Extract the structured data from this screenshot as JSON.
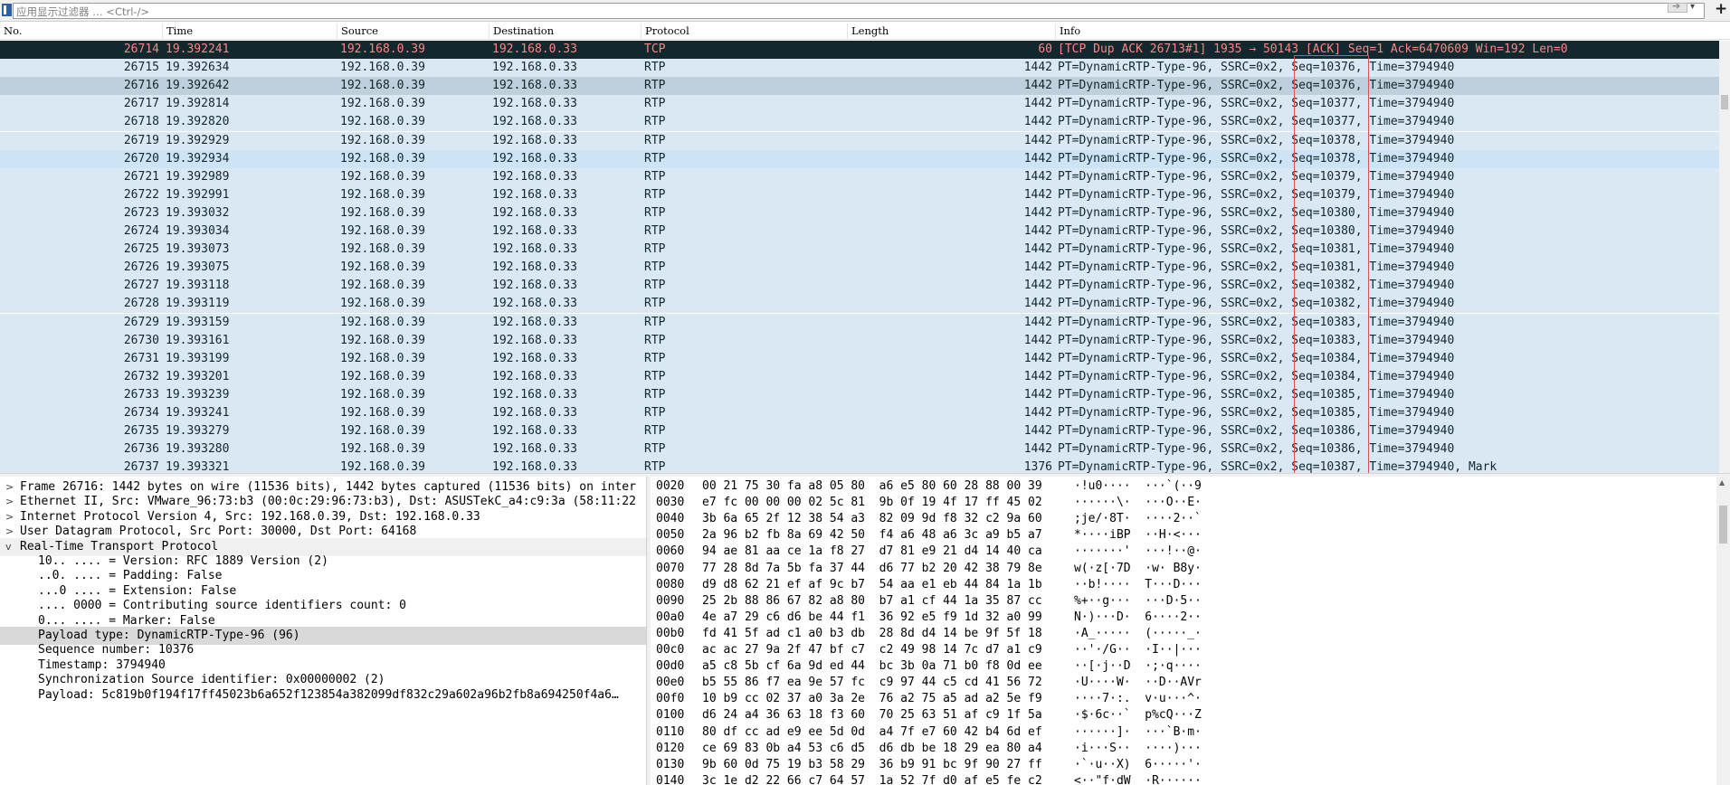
{
  "filter": {
    "placeholder": "应用显示过滤器 … <Ctrl-/>",
    "apply_icon": "arrow-right-icon",
    "dropdown_icon": "chevron-down-icon",
    "add_label": "+"
  },
  "packet_list": {
    "columns": [
      "No.",
      "Time",
      "Source",
      "Destination",
      "Protocol",
      "Length",
      "Info"
    ],
    "rows": [
      {
        "no": "26714",
        "time": "19.392241",
        "src": "192.168.0.39",
        "dst": "192.168.0.33",
        "proto": "TCP",
        "len": "60",
        "info": "[TCP Dup ACK 26713#1] 1935 → 50143 [ACK] Seq=1 Ack=6470609 Win=192 Len=0"
      },
      {
        "no": "26715",
        "time": "19.392634",
        "src": "192.168.0.39",
        "dst": "192.168.0.33",
        "proto": "RTP",
        "len": "1442",
        "info": "PT=DynamicRTP-Type-96, SSRC=0x2, Seq=10376, Time=3794940"
      },
      {
        "no": "26716",
        "time": "19.392642",
        "src": "192.168.0.39",
        "dst": "192.168.0.33",
        "proto": "RTP",
        "len": "1442",
        "info": "PT=DynamicRTP-Type-96, SSRC=0x2, Seq=10376, Time=3794940"
      },
      {
        "no": "26717",
        "time": "19.392814",
        "src": "192.168.0.39",
        "dst": "192.168.0.33",
        "proto": "RTP",
        "len": "1442",
        "info": "PT=DynamicRTP-Type-96, SSRC=0x2, Seq=10377, Time=3794940"
      },
      {
        "no": "26718",
        "time": "19.392820",
        "src": "192.168.0.39",
        "dst": "192.168.0.33",
        "proto": "RTP",
        "len": "1442",
        "info": "PT=DynamicRTP-Type-96, SSRC=0x2, Seq=10377, Time=3794940"
      },
      {
        "no": "26719",
        "time": "19.392929",
        "src": "192.168.0.39",
        "dst": "192.168.0.33",
        "proto": "RTP",
        "len": "1442",
        "info": "PT=DynamicRTP-Type-96, SSRC=0x2, Seq=10378, Time=3794940"
      },
      {
        "no": "26720",
        "time": "19.392934",
        "src": "192.168.0.39",
        "dst": "192.168.0.33",
        "proto": "RTP",
        "len": "1442",
        "info": "PT=DynamicRTP-Type-96, SSRC=0x2, Seq=10378, Time=3794940"
      },
      {
        "no": "26721",
        "time": "19.392989",
        "src": "192.168.0.39",
        "dst": "192.168.0.33",
        "proto": "RTP",
        "len": "1442",
        "info": "PT=DynamicRTP-Type-96, SSRC=0x2, Seq=10379, Time=3794940"
      },
      {
        "no": "26722",
        "time": "19.392991",
        "src": "192.168.0.39",
        "dst": "192.168.0.33",
        "proto": "RTP",
        "len": "1442",
        "info": "PT=DynamicRTP-Type-96, SSRC=0x2, Seq=10379, Time=3794940"
      },
      {
        "no": "26723",
        "time": "19.393032",
        "src": "192.168.0.39",
        "dst": "192.168.0.33",
        "proto": "RTP",
        "len": "1442",
        "info": "PT=DynamicRTP-Type-96, SSRC=0x2, Seq=10380, Time=3794940"
      },
      {
        "no": "26724",
        "time": "19.393034",
        "src": "192.168.0.39",
        "dst": "192.168.0.33",
        "proto": "RTP",
        "len": "1442",
        "info": "PT=DynamicRTP-Type-96, SSRC=0x2, Seq=10380, Time=3794940"
      },
      {
        "no": "26725",
        "time": "19.393073",
        "src": "192.168.0.39",
        "dst": "192.168.0.33",
        "proto": "RTP",
        "len": "1442",
        "info": "PT=DynamicRTP-Type-96, SSRC=0x2, Seq=10381, Time=3794940"
      },
      {
        "no": "26726",
        "time": "19.393075",
        "src": "192.168.0.39",
        "dst": "192.168.0.33",
        "proto": "RTP",
        "len": "1442",
        "info": "PT=DynamicRTP-Type-96, SSRC=0x2, Seq=10381, Time=3794940"
      },
      {
        "no": "26727",
        "time": "19.393118",
        "src": "192.168.0.39",
        "dst": "192.168.0.33",
        "proto": "RTP",
        "len": "1442",
        "info": "PT=DynamicRTP-Type-96, SSRC=0x2, Seq=10382, Time=3794940"
      },
      {
        "no": "26728",
        "time": "19.393119",
        "src": "192.168.0.39",
        "dst": "192.168.0.33",
        "proto": "RTP",
        "len": "1442",
        "info": "PT=DynamicRTP-Type-96, SSRC=0x2, Seq=10382, Time=3794940"
      },
      {
        "no": "26729",
        "time": "19.393159",
        "src": "192.168.0.39",
        "dst": "192.168.0.33",
        "proto": "RTP",
        "len": "1442",
        "info": "PT=DynamicRTP-Type-96, SSRC=0x2, Seq=10383, Time=3794940"
      },
      {
        "no": "26730",
        "time": "19.393161",
        "src": "192.168.0.39",
        "dst": "192.168.0.33",
        "proto": "RTP",
        "len": "1442",
        "info": "PT=DynamicRTP-Type-96, SSRC=0x2, Seq=10383, Time=3794940"
      },
      {
        "no": "26731",
        "time": "19.393199",
        "src": "192.168.0.39",
        "dst": "192.168.0.33",
        "proto": "RTP",
        "len": "1442",
        "info": "PT=DynamicRTP-Type-96, SSRC=0x2, Seq=10384, Time=3794940"
      },
      {
        "no": "26732",
        "time": "19.393201",
        "src": "192.168.0.39",
        "dst": "192.168.0.33",
        "proto": "RTP",
        "len": "1442",
        "info": "PT=DynamicRTP-Type-96, SSRC=0x2, Seq=10384, Time=3794940"
      },
      {
        "no": "26733",
        "time": "19.393239",
        "src": "192.168.0.39",
        "dst": "192.168.0.33",
        "proto": "RTP",
        "len": "1442",
        "info": "PT=DynamicRTP-Type-96, SSRC=0x2, Seq=10385, Time=3794940"
      },
      {
        "no": "26734",
        "time": "19.393241",
        "src": "192.168.0.39",
        "dst": "192.168.0.33",
        "proto": "RTP",
        "len": "1442",
        "info": "PT=DynamicRTP-Type-96, SSRC=0x2, Seq=10385, Time=3794940"
      },
      {
        "no": "26735",
        "time": "19.393279",
        "src": "192.168.0.39",
        "dst": "192.168.0.33",
        "proto": "RTP",
        "len": "1442",
        "info": "PT=DynamicRTP-Type-96, SSRC=0x2, Seq=10386, Time=3794940"
      },
      {
        "no": "26736",
        "time": "19.393280",
        "src": "192.168.0.39",
        "dst": "192.168.0.33",
        "proto": "RTP",
        "len": "1442",
        "info": "PT=DynamicRTP-Type-96, SSRC=0x2, Seq=10386, Time=3794940"
      },
      {
        "no": "26737",
        "time": "19.393321",
        "src": "192.168.0.39",
        "dst": "192.168.0.33",
        "proto": "RTP",
        "len": "1376",
        "info": "PT=DynamicRTP-Type-96, SSRC=0x2, Seq=10387, Time=3794940, Mark"
      }
    ],
    "colors": {
      "rtp_bg": "#dae8f4",
      "rtp_fg": "#12272e",
      "tcp_bg": "#12272e",
      "tcp_fg": "#f78787",
      "selected_bg": "#bfcfdc",
      "seq_highlight": "#e05050"
    }
  },
  "details": {
    "rows": [
      {
        "twisty": ">",
        "level": 0,
        "text": "Frame 26716: 1442 bytes on wire (11536 bits), 1442 bytes captured (11536 bits) on inter"
      },
      {
        "twisty": ">",
        "level": 0,
        "text": "Ethernet II, Src: VMware_96:73:b3 (00:0c:29:96:73:b3), Dst: ASUSTekC_a4:c9:3a (58:11:22"
      },
      {
        "twisty": ">",
        "level": 0,
        "text": "Internet Protocol Version 4, Src: 192.168.0.39, Dst: 192.168.0.33"
      },
      {
        "twisty": ">",
        "level": 0,
        "text": "User Datagram Protocol, Src Port: 30000, Dst Port: 64168"
      },
      {
        "twisty": "v",
        "level": 0,
        "text": "Real-Time Transport Protocol"
      },
      {
        "twisty": "",
        "level": 1,
        "text": "10.. .... = Version: RFC 1889 Version (2)"
      },
      {
        "twisty": "",
        "level": 1,
        "text": "..0. .... = Padding: False"
      },
      {
        "twisty": "",
        "level": 1,
        "text": "...0 .... = Extension: False"
      },
      {
        "twisty": "",
        "level": 1,
        "text": ".... 0000 = Contributing source identifiers count: 0"
      },
      {
        "twisty": "",
        "level": 1,
        "text": "0... .... = Marker: False"
      },
      {
        "twisty": "",
        "level": 1,
        "text": "Payload type: DynamicRTP-Type-96 (96)"
      },
      {
        "twisty": "",
        "level": 1,
        "text": "Sequence number: 10376"
      },
      {
        "twisty": "",
        "level": 1,
        "text": "Timestamp: 3794940"
      },
      {
        "twisty": "",
        "level": 1,
        "text": "Synchronization Source identifier: 0x00000002 (2)"
      },
      {
        "twisty": "",
        "level": 1,
        "text": "Payload: 5c819b0f194f17ff45023b6a652f123854a382099df832c29a602a96b2fb8a694250f4a6…"
      }
    ]
  },
  "hex": {
    "rows": [
      {
        "offset": "0020",
        "bytes": "00 21 75 30 fa a8 05 80  a6 e5 80 60 28 88 00 39",
        "ascii": "·!u0····  ···`(··9"
      },
      {
        "offset": "0030",
        "bytes": "e7 fc 00 00 00 02 5c 81  9b 0f 19 4f 17 ff 45 02",
        "ascii": "······\\·  ···O··E·"
      },
      {
        "offset": "0040",
        "bytes": "3b 6a 65 2f 12 38 54 a3  82 09 9d f8 32 c2 9a 60",
        "ascii": ";je/·8T·  ····2··`"
      },
      {
        "offset": "0050",
        "bytes": "2a 96 b2 fb 8a 69 42 50  f4 a6 48 a6 3c a9 b5 a7",
        "ascii": "*····iBP  ··H·<···"
      },
      {
        "offset": "0060",
        "bytes": "94 ae 81 aa ce 1a f8 27  d7 81 e9 21 d4 14 40 ca",
        "ascii": "·······'  ···!··@·"
      },
      {
        "offset": "0070",
        "bytes": "77 28 8d 7a 5b fa 37 44  d6 77 b2 20 42 38 79 8e",
        "ascii": "w(·z[·7D  ·w· B8y·"
      },
      {
        "offset": "0080",
        "bytes": "d9 d8 62 21 ef af 9c b7  54 aa e1 eb 44 84 1a 1b",
        "ascii": "··b!····  T···D···"
      },
      {
        "offset": "0090",
        "bytes": "25 2b 88 86 67 82 a8 80  b7 a1 cf 44 1a 35 87 cc",
        "ascii": "%+··g···  ···D·5··"
      },
      {
        "offset": "00a0",
        "bytes": "4e a7 29 c6 d6 be 44 f1  36 92 e5 f9 1d 32 a0 99",
        "ascii": "N·)···D·  6····2··"
      },
      {
        "offset": "00b0",
        "bytes": "fd 41 5f ad c1 a0 b3 db  28 8d d4 14 be 9f 5f 18",
        "ascii": "·A_·····  (·····_·"
      },
      {
        "offset": "00c0",
        "bytes": "ac ac 27 9a 2f 47 bf c7  c2 49 98 14 7c d7 a1 c9",
        "ascii": "··'·/G··  ·I··|···"
      },
      {
        "offset": "00d0",
        "bytes": "a5 c8 5b cf 6a 9d ed 44  bc 3b 0a 71 b0 f8 0d ee",
        "ascii": "··[·j··D  ·;·q····"
      },
      {
        "offset": "00e0",
        "bytes": "b5 55 86 f7 ea 9e 57 fc  c9 97 44 c5 cd 41 56 72",
        "ascii": "·U····W·  ··D··AVr"
      },
      {
        "offset": "00f0",
        "bytes": "10 b9 cc 02 37 a0 3a 2e  76 a2 75 a5 ad a2 5e f9",
        "ascii": "····7·:.  v·u···^·"
      },
      {
        "offset": "0100",
        "bytes": "d6 24 a4 36 63 18 f3 60  70 25 63 51 af c9 1f 5a",
        "ascii": "·$·6c··`  p%cQ···Z"
      },
      {
        "offset": "0110",
        "bytes": "80 df cc ad e9 ee 5d 0d  a4 7f e7 60 42 b4 6d ef",
        "ascii": "······]·  ···`B·m·"
      },
      {
        "offset": "0120",
        "bytes": "ce 69 83 0b a4 53 c6 d5  d6 db be 18 29 ea 80 a4",
        "ascii": "·i···S··  ····)···"
      },
      {
        "offset": "0130",
        "bytes": "9b 60 0d 75 19 b3 58 29  36 b9 91 bc 9f 90 27 ff",
        "ascii": "·`·u··X)  6·····'·"
      },
      {
        "offset": "0140",
        "bytes": "3c 1e d2 22 66 c7 64 57  1a 52 7f d0 af e5 fe c2",
        "ascii": "<··\"f·dW  ·R······"
      }
    ]
  }
}
